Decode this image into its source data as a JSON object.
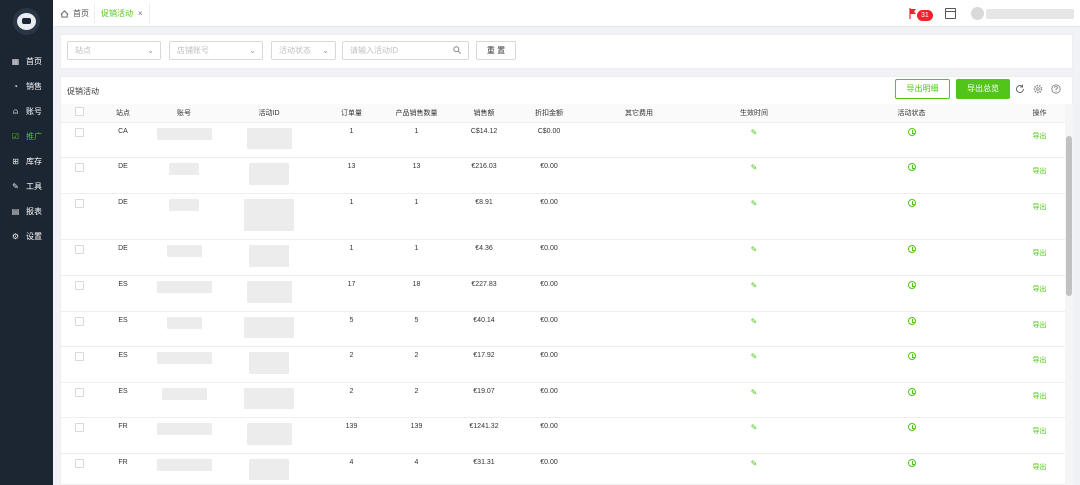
{
  "sidebar": {
    "items": [
      {
        "label": "首页",
        "icon": "grid-icon",
        "glyph": "▦",
        "active": false
      },
      {
        "label": "销售",
        "icon": "pie-chart-icon",
        "glyph": "◔",
        "active": false
      },
      {
        "label": "账号",
        "icon": "user-icon",
        "glyph": "⍝",
        "active": false
      },
      {
        "label": "推广",
        "icon": "check-square-icon",
        "glyph": "☑",
        "active": true
      },
      {
        "label": "库存",
        "icon": "stock-icon",
        "glyph": "⊞",
        "active": false
      },
      {
        "label": "工具",
        "icon": "wrench-icon",
        "glyph": "✎",
        "active": false
      },
      {
        "label": "报表",
        "icon": "table-icon",
        "glyph": "▤",
        "active": false
      },
      {
        "label": "设置",
        "icon": "gear-icon",
        "glyph": "⚙",
        "active": false
      }
    ]
  },
  "topbar": {
    "tabs": [
      {
        "label": "首页"
      },
      {
        "label": "促销活动"
      }
    ],
    "close_glyph": "×",
    "notification_count": "31"
  },
  "filters": {
    "site_placeholder": "站点",
    "account_placeholder": "店铺账号",
    "status_placeholder": "活动状态",
    "search_placeholder": "请输入活动ID",
    "reset_label": "重 置"
  },
  "panel": {
    "title": "促销活动",
    "export_detail_label": "导出明细",
    "export_summary_label": "导出总览"
  },
  "table": {
    "columns": [
      "",
      "站点",
      "账号",
      "活动ID",
      "订单量",
      "产品销售数量",
      "销售额",
      "折扣金额",
      "其它费用",
      "生效时间",
      "活动状态",
      "操作"
    ],
    "op_label": "导出",
    "rows": [
      {
        "site": "CA",
        "orders": "1",
        "units": "1",
        "sales": "C$14.12",
        "discount": "C$0.00"
      },
      {
        "site": "DE",
        "orders": "13",
        "units": "13",
        "sales": "€216.03",
        "discount": "€0.00"
      },
      {
        "site": "DE",
        "orders": "1",
        "units": "1",
        "sales": "€8.91",
        "discount": "€0.00"
      },
      {
        "site": "DE",
        "orders": "1",
        "units": "1",
        "sales": "€4.36",
        "discount": "€0.00"
      },
      {
        "site": "ES",
        "orders": "17",
        "units": "18",
        "sales": "€227.83",
        "discount": "€0.00"
      },
      {
        "site": "ES",
        "orders": "5",
        "units": "5",
        "sales": "€40.14",
        "discount": "€0.00"
      },
      {
        "site": "ES",
        "orders": "2",
        "units": "2",
        "sales": "€17.92",
        "discount": "€0.00"
      },
      {
        "site": "ES",
        "orders": "2",
        "units": "2",
        "sales": "€19.07",
        "discount": "€0.00"
      },
      {
        "site": "FR",
        "orders": "139",
        "units": "139",
        "sales": "€1241.32",
        "discount": "€0.00"
      },
      {
        "site": "FR",
        "orders": "4",
        "units": "4",
        "sales": "€31.31",
        "discount": "€0.00"
      }
    ]
  },
  "colors": {
    "accent": "#52c41a",
    "sidebar": "#1c2633",
    "badge": "#f5222d"
  }
}
